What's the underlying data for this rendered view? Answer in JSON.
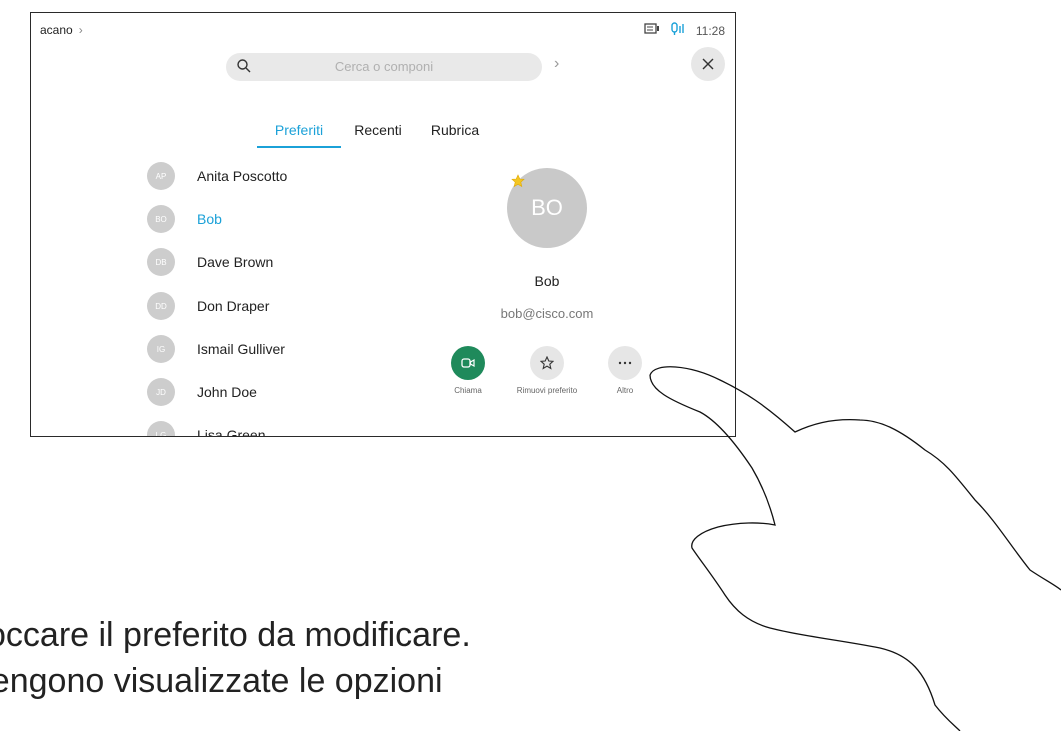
{
  "status": {
    "system": "acano",
    "time": "11:28"
  },
  "search": {
    "placeholder": "Cerca o componi"
  },
  "tabs": [
    {
      "label": "Preferiti",
      "active": true
    },
    {
      "label": "Recenti",
      "active": false
    },
    {
      "label": "Rubrica",
      "active": false
    }
  ],
  "contacts": [
    {
      "initials": "AP",
      "name": "Anita Poscotto"
    },
    {
      "initials": "BO",
      "name": "Bob",
      "selected": true
    },
    {
      "initials": "DB",
      "name": "Dave Brown"
    },
    {
      "initials": "DD",
      "name": "Don Draper"
    },
    {
      "initials": "IG",
      "name": "Ismail Gulliver"
    },
    {
      "initials": "JD",
      "name": "John Doe"
    },
    {
      "initials": "LG",
      "name": "Lisa Green"
    }
  ],
  "detail": {
    "initials": "BO",
    "name": "Bob",
    "email": "bob@cisco.com",
    "actions": [
      {
        "label": "Chiama",
        "icon": "video-camera-icon"
      },
      {
        "label": "Rimuovi preferito",
        "icon": "star-icon"
      },
      {
        "label": "Altro",
        "icon": "more-icon"
      }
    ]
  },
  "caption": {
    "line1": "Toccare il preferito da modificare.",
    "line2": "Vengono visualizzate le opzioni"
  },
  "colors": {
    "accent": "#1ba1d8",
    "call": "#1f8a5b"
  }
}
